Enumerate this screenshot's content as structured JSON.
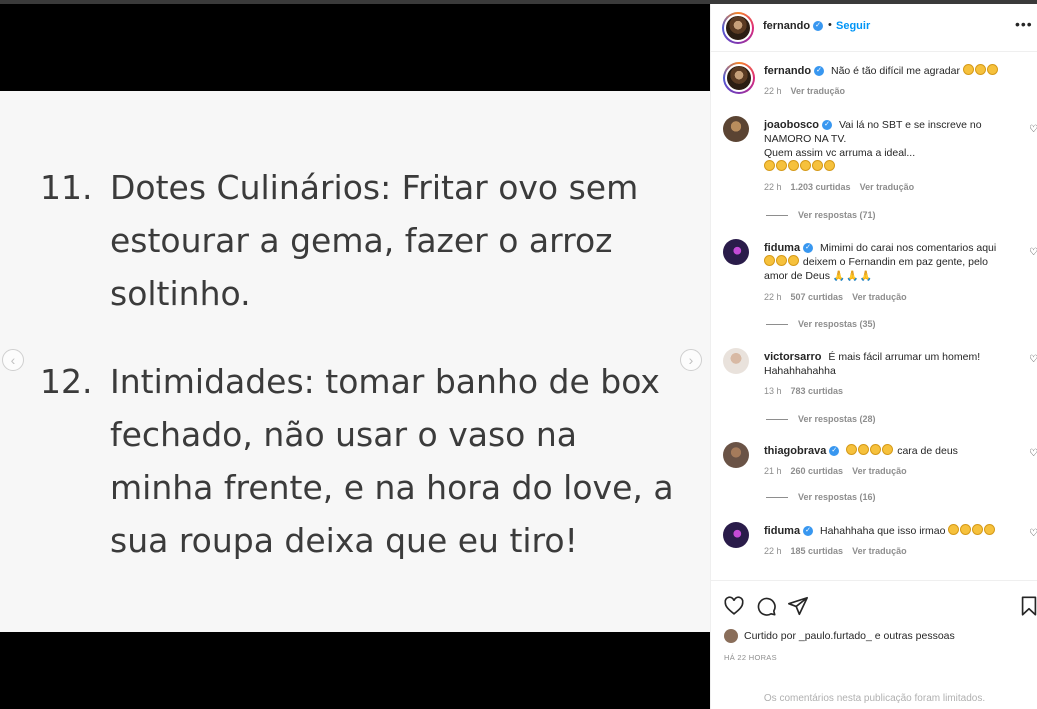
{
  "post": {
    "items": [
      {
        "num": "11.",
        "text": "Dotes Culinários: Fritar ovo sem estourar a gema, fazer o arroz soltinho."
      },
      {
        "num": "12.",
        "text": "Intimidades: tomar banho de box fechado, não usar o vaso na minha frente, e na hora do love, a sua roupa deixa que eu tiro!"
      }
    ],
    "prev_icon": "‹",
    "next_icon": "›"
  },
  "header": {
    "username": "fernando",
    "separator": "•",
    "follow_label": "Seguir",
    "more_icon": "•••"
  },
  "caption": {
    "username": "fernando",
    "text": "Não é tão difícil me agradar",
    "emoji_count": 3,
    "time": "22 h",
    "translate": "Ver tradução"
  },
  "comments": [
    {
      "username": "joaobosco",
      "verified": true,
      "text_lines": [
        "Vai lá no SBT e se inscreve no",
        "NAMORO NA TV.",
        "Quem assim vc arruma a ideal..."
      ],
      "time": "22 h",
      "likes": "1.203 curtidas",
      "translate": "Ver tradução",
      "replies": "Ver respostas (71)"
    },
    {
      "username": "fiduma",
      "verified": true,
      "text_a": "Mimimi do carai nos comentarios aqui",
      "text_b": "deixem o Fernandin em paz gente, pelo",
      "text_c": "amor de Deus",
      "time": "22 h",
      "likes": "507 curtidas",
      "translate": "Ver tradução",
      "replies": "Ver respostas (35)"
    },
    {
      "username": "victorsarro",
      "verified": false,
      "text": "É mais fácil arrumar um homem!",
      "text2": "Hahahhahahha",
      "time": "13 h",
      "likes": "783 curtidas",
      "replies": "Ver respostas (28)"
    },
    {
      "username": "thiagobrava",
      "verified": true,
      "text": "cara de deus",
      "time": "21 h",
      "likes": "260 curtidas",
      "translate": "Ver tradução",
      "replies": "Ver respostas (16)"
    },
    {
      "username": "fiduma",
      "verified": true,
      "text": "Hahahhaha que isso irmao",
      "time": "22 h",
      "likes": "185 curtidas",
      "translate": "Ver tradução"
    }
  ],
  "actions": {
    "liked_by_prefix": "Curtido por",
    "liked_by_user": "_paulo.furtado_",
    "liked_by_suffix": "e outras pessoas",
    "ago": "HÁ 22 HORAS",
    "limited": "Os comentários nesta publicação foram limitados."
  },
  "colors": {
    "link": "#0095f6",
    "verified": "#3897f0",
    "muted": "#8e8e8e"
  }
}
